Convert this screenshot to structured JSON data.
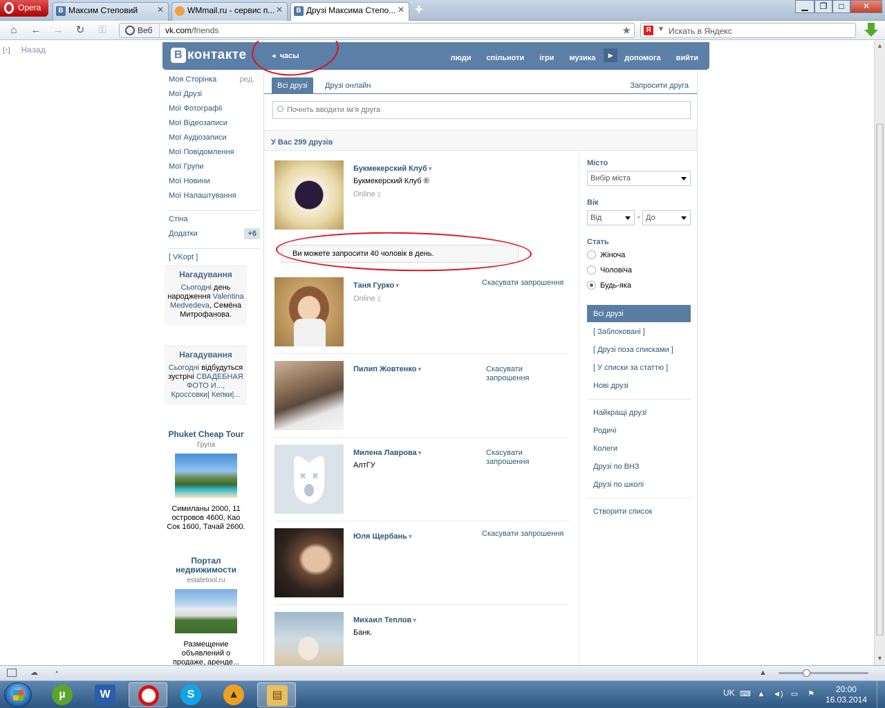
{
  "browser": {
    "menu_label": "Opera",
    "tabs": [
      {
        "title": "Максим Степовий",
        "favicon": "vk-icon"
      },
      {
        "title": "WMmail.ru - сервис п...",
        "favicon": "wmmail-icon"
      },
      {
        "title": "Друзі Максима Степо...",
        "favicon": "vk-icon",
        "active": true
      }
    ],
    "address_prefix": "Веб",
    "url_domain": "vk.com",
    "url_path": "/friends",
    "search_placeholder": "Искать в Яндекс",
    "back_link": "Назад",
    "back_link_marker": "[↑]"
  },
  "vk": {
    "logo": "контакте",
    "logo_letter": "В",
    "player_label": "часы",
    "menu": [
      "люди",
      "спільноти",
      "ігри",
      "музика",
      "допомога",
      "вийти"
    ],
    "left_menu": [
      {
        "label": "Моя Сторінка",
        "extra": "ред."
      },
      {
        "label": "Мої Друзі"
      },
      {
        "label": "Мої Фотографії"
      },
      {
        "label": "Мої Відеозаписи"
      },
      {
        "label": "Мої Аудіозаписи"
      },
      {
        "label": "Мої Повідомлення"
      },
      {
        "label": "Мої Групи"
      },
      {
        "label": "Мої Новини"
      },
      {
        "label": "Мої Налаштування"
      },
      {
        "label": "Стіна"
      },
      {
        "label": "Додатки",
        "badge": "+6"
      },
      {
        "label": "[ VKopt ]"
      }
    ],
    "reminders": [
      {
        "title": "Нагадування",
        "today": "Сьогодні",
        "text_a": "день народження",
        "names": "Valentina Medvedeva",
        "text_b": ", Семёна Митрофанова."
      },
      {
        "title": "Нагадування",
        "today": "Сьогодні",
        "text_a": "відбудуться зустрічі",
        "links": "СВАДЕБНАЯ ФОТО И..., Кроссовки| Кепки|..."
      }
    ],
    "ads": [
      {
        "title": "Phuket Cheap Tour",
        "sub": "Група",
        "text": "Симиланы 2000, 11 островов 4600, Као Сок 1600, Тачай 2600."
      },
      {
        "title": "Портал недвижимости",
        "sub": "estatetool.ru",
        "text": "Размещение объявлений о продаже, аренде..."
      }
    ],
    "tabs": {
      "all": "Всі друзі",
      "online": "Друзі онлайн",
      "invite": "Запросити друга"
    },
    "search_placeholder": "Почніть вводити ім'я друга",
    "count_text": "У Вас 299 друзів",
    "notice": "Ви можете запросити 40 чоловік в день.",
    "friends": [
      {
        "name": "Букмекерский Клуб",
        "sub": "Букмекерский Клуб ®",
        "online": "Online",
        "cancel": ""
      },
      {
        "name": "Таня Гурко",
        "sub": "",
        "online": "Online",
        "cancel": "Скасувати запрошення"
      },
      {
        "name": "Пилип Жовтенко",
        "sub": "",
        "online": "",
        "cancel": "Скасувати запрошення"
      },
      {
        "name": "Милена Лаврова",
        "sub": "АлтГУ",
        "online": "",
        "cancel": "Скасувати запрошення"
      },
      {
        "name": "Юля Щербань",
        "sub": "",
        "online": "",
        "cancel": "Скасувати запрошення"
      },
      {
        "name": "Михаил Теплов",
        "sub": "Банк.",
        "online": "",
        "cancel": ""
      }
    ],
    "filters": {
      "city_label": "Місто",
      "city_select": "Вибір міста",
      "age_label": "Вік",
      "age_from": "Від",
      "age_dash": "-",
      "age_to": "До",
      "sex_label": "Стать",
      "sex_options": [
        "Жіноча",
        "Чоловіча",
        "Будь-яка"
      ],
      "sex_selected": "Будь-яка",
      "lists_a": [
        "Всі друзі",
        "[ Заблоковані ]",
        "[ Друзі поза списками ]",
        "[ У списки за статтю ]",
        "Нові друзі"
      ],
      "lists_b": [
        "Найкращі друзі",
        "Родичі",
        "Колеги",
        "Друзі по ВНЗ",
        "Друзі по школі"
      ],
      "create_list": "Створити список"
    }
  },
  "taskbar": {
    "apps": [
      "utorrent-icon",
      "word-icon",
      "opera-icon",
      "skype-icon",
      "aimp-icon",
      "explorer-icon"
    ],
    "lang": "UK",
    "time": "20:00",
    "date": "16.03.2014"
  },
  "colors": {
    "vk_blue": "#5b7fa6",
    "link": "#2b587a",
    "annotation_red": "#e0101a"
  }
}
